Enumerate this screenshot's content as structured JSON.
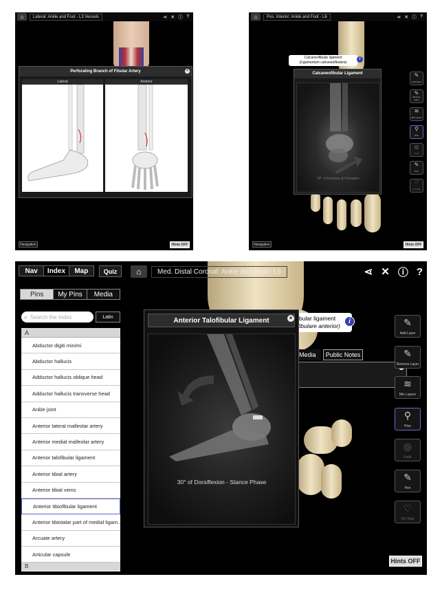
{
  "screen1": {
    "breadcrumb": "Lateral: Ankle and Foot - L3 Vessels",
    "popup_title": "Perforating Branch of Fibular Artery",
    "view_left": "Lateral",
    "view_right": "Anterior",
    "navigation_label": "Navigation",
    "hints_label": "Hints OFF"
  },
  "screen2": {
    "breadcrumb": "Pos. Interior: Ankle and Foot - L6",
    "pin_label_line1": "Calcaneofibular ligament",
    "pin_label_line2": "(Ligamentum calcaneofibulare)",
    "popup_title": "Calcaneofibular Ligament",
    "caption": "30° of Eversion & Pronation",
    "side_buttons": [
      "Add Layer",
      "Remove Layer",
      "Mix Layers",
      "Pins",
      "Fade",
      "Pen",
      "DIY Map"
    ],
    "navigation_label": "Navigation",
    "hints_label": "Hints OFF"
  },
  "screen3": {
    "top_tabs": [
      "Nav",
      "Index",
      "Map"
    ],
    "quiz_label": "Quiz",
    "breadcrumb": "Med. Distal Coronal: Ankle and Foot - L6",
    "sub_tabs": [
      "Pins",
      "My Pins",
      "Media"
    ],
    "search_placeholder": "Search the Index",
    "latin_label": "Latin",
    "section_letter": "A",
    "next_section_letter": "B",
    "index_items": [
      "Abductor digiti minimi",
      "Abductor hallucis",
      "Adductor hallucis oblique head",
      "Adductor hallucis transverse head",
      "Ankle joint",
      "Anterior lateral malleolar artery",
      "Anterior medial malleolar artery",
      "Anterior talofibular ligament",
      "Anterior tibial artery",
      "Anterior tibial veins",
      "Anterior tibiofibular ligament",
      "Anterior tibiotalar part of medial ligam...",
      "Arcuate artery",
      "Articular capsule"
    ],
    "selected_index": 10,
    "popup_title": "Anterior Talofibular Ligament",
    "caption": "30° of Dorsiflexion - Stance Phase",
    "pin_label_line1": "ibular ligament",
    "pin_label_line2": "fibulare anterior)",
    "tab_media": "Media",
    "tab_public_notes": "Public Notes",
    "side_buttons": [
      "Add Layer",
      "Remove Layer",
      "Mix Layers",
      "Pins",
      "Fade",
      "Pen",
      "DIY Map"
    ],
    "hints_label": "Hints OFF"
  }
}
